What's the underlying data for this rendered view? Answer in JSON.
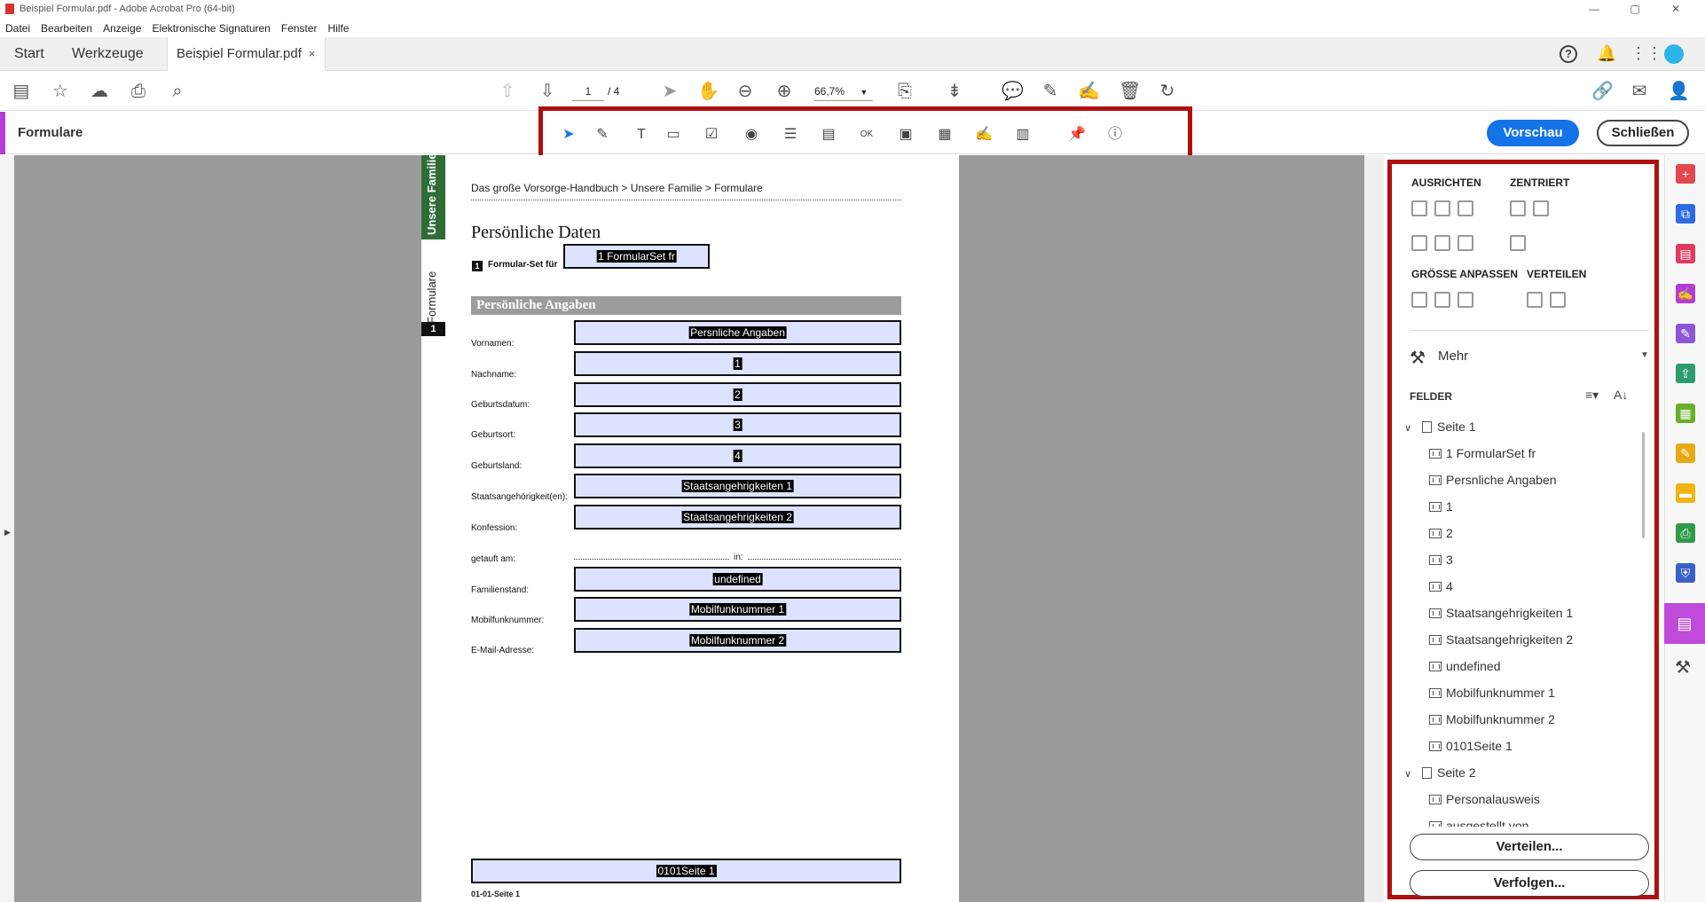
{
  "window": {
    "title": "Beispiel Formular.pdf - Adobe Acrobat Pro (64-bit)",
    "controls": {
      "minimize": "—",
      "maximize": "▢",
      "close": "✕"
    }
  },
  "menu": [
    "Datei",
    "Bearbeiten",
    "Anzeige",
    "Elektronische Signaturen",
    "Fenster",
    "Hilfe"
  ],
  "tabs": {
    "start": "Start",
    "tools": "Werkzeuge",
    "document": "Beispiel Formular.pdf",
    "close": "×"
  },
  "toolbar": {
    "page_current": "1",
    "page_total": "/ 4",
    "zoom": "66,7%"
  },
  "forms_bar": {
    "label": "Formulare",
    "preview_button": "Vorschau",
    "close_button": "Schließen"
  },
  "document": {
    "side_tab_green": "Unsere Familie",
    "side_tab": "Formulare",
    "side_tab_number": "1",
    "breadcrumb": "Das große Vorsorge-Handbuch > Unsere Familie > Formulare",
    "title": "Persönliche Daten",
    "set_number": "1",
    "set_label": "Formular-Set für",
    "set_field": "1 FormularSet fr",
    "section": "Persönliche Angaben",
    "header_field": "Persnliche Angaben",
    "rows": [
      {
        "label": "Vornamen:",
        "field": "1"
      },
      {
        "label": "Nachname:",
        "field": "2"
      },
      {
        "label": "Geburtsdatum:",
        "field": "3"
      },
      {
        "label": "Geburtsort:",
        "field": "4"
      },
      {
        "label": "Geburtsland:",
        "field": "Staatsangehrigkeiten 1"
      },
      {
        "label": "Staatsangehörigkeit(en):",
        "field": "Staatsangehrigkeiten 2"
      },
      {
        "label": "Konfession:",
        "field": ""
      },
      {
        "label": "getauft am:",
        "field": ""
      },
      {
        "label": "Familienstand:",
        "field": "undefined"
      },
      {
        "label": "Mobilfunknummer:",
        "field": "Mobilfunknummer 1"
      },
      {
        "label": "E-Mail-Adresse:",
        "field": "Mobilfunknummer 2"
      }
    ],
    "in_label": "in:",
    "footer_field": "0101Seite 1",
    "footer_label": "01-01-Seite 1"
  },
  "right_panel": {
    "align_heading": "AUSRICHTEN",
    "center_heading": "ZENTRIERT",
    "size_heading": "GRÖSSE ANPASSEN",
    "distribute_heading": "VERTEILEN",
    "more": "Mehr",
    "fields_heading": "FELDER",
    "page1": "Seite 1",
    "page1_fields": [
      "1 FormularSet fr",
      "Persnliche Angaben",
      "1",
      "2",
      "3",
      "4",
      "Staatsangehrigkeiten 1",
      "Staatsangehrigkeiten 2",
      "undefined",
      "Mobilfunknummer 1",
      "Mobilfunknummer 2",
      "0101Seite 1"
    ],
    "page2": "Seite 2",
    "page2_fields": [
      "Personalausweis",
      "ausgestellt von"
    ],
    "distribute_button": "Verteilen...",
    "track_button": "Verfolgen..."
  },
  "colors": {
    "accent_red": "#b00f0f",
    "primary_blue": "#1473e6",
    "forms_purple": "#b63bd6",
    "field_fill": "#dde3ff"
  }
}
